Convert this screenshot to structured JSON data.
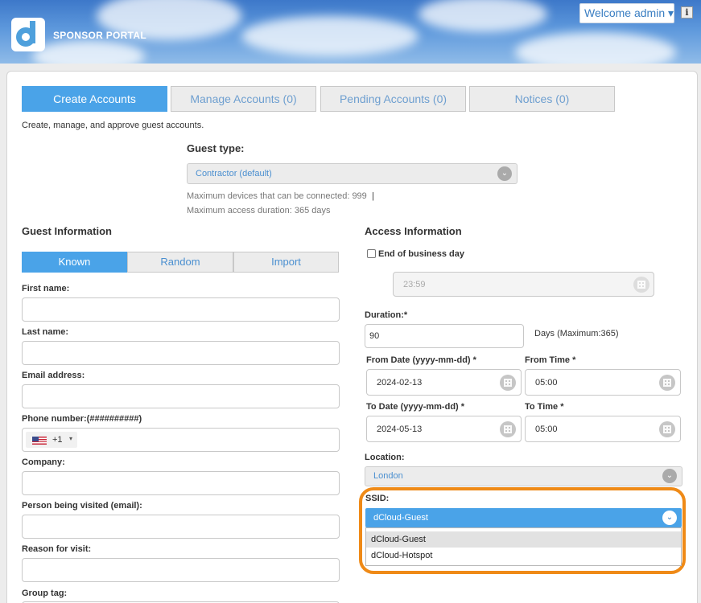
{
  "header": {
    "brand": "SPONSOR PORTAL",
    "welcome": "Welcome admin ▾",
    "info_icon": "i"
  },
  "tabs": [
    {
      "label": "Create Accounts",
      "active": true
    },
    {
      "label": "Manage Accounts (0)",
      "active": false
    },
    {
      "label": "Pending Accounts (0)",
      "active": false
    },
    {
      "label": "Notices (0)",
      "active": false
    }
  ],
  "description": "Create, manage, and approve guest accounts.",
  "guest_type": {
    "label": "Guest type:",
    "value": "Contractor (default)",
    "max_devices": "Maximum devices that can be connected: 999",
    "separator": "|",
    "max_duration": "Maximum access duration: 365 days"
  },
  "guest_info": {
    "heading": "Guest Information",
    "subtabs": [
      {
        "label": "Known",
        "active": true
      },
      {
        "label": "Random",
        "active": false
      },
      {
        "label": "Import",
        "active": false
      }
    ],
    "fields": {
      "first_name": "First name:",
      "last_name": "Last name:",
      "email": "Email address:",
      "phone": "Phone number:(##########)",
      "country_code": "+1",
      "company": "Company:",
      "person_visited": "Person being visited (email):",
      "reason": "Reason for visit:",
      "group_tag": "Group tag:"
    }
  },
  "access_info": {
    "heading": "Access Information",
    "end_of_day": "End of business day",
    "end_time_placeholder": "23:59",
    "duration_label": "Duration:*",
    "duration_value": "90",
    "duration_note": "Days (Maximum:365)",
    "from_date_label": "From Date (yyyy-mm-dd) *",
    "from_date": "2024-02-13",
    "from_time_label": "From Time *",
    "from_time": "05:00",
    "to_date_label": "To Date (yyyy-mm-dd) *",
    "to_date": "2024-05-13",
    "to_time_label": "To Time *",
    "to_time": "05:00",
    "location_label": "Location:",
    "location": "London",
    "ssid_label": "SSID:",
    "ssid_selected": "dCloud-Guest",
    "ssid_options": [
      "dCloud-Guest",
      "dCloud-Hotspot"
    ]
  },
  "colors": {
    "accent": "#4aa3e8",
    "highlight": "#ef8a17"
  }
}
